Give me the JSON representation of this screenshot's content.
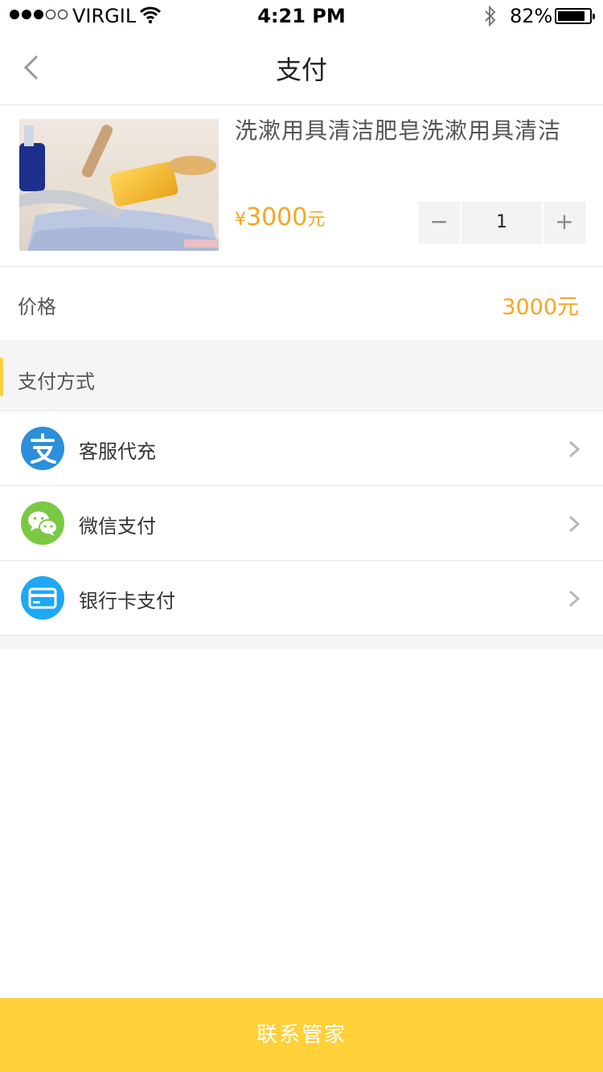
{
  "status_bar": {
    "carrier": "VIRGIL",
    "time": "4:21 PM",
    "battery_percent": "82%",
    "signal_bars_filled": 3,
    "signal_bars_total": 5,
    "battery_level": 0.82
  },
  "nav": {
    "title": "支付",
    "back_icon": "chevron-left-icon"
  },
  "product": {
    "title": "洗漱用具清洁肥皂洗漱用具清洁",
    "price_symbol": "¥",
    "price": "3000",
    "price_unit": "元",
    "quantity": "1",
    "minus_label": "−",
    "plus_label": "+"
  },
  "price_row": {
    "label": "价格",
    "value": "3000元"
  },
  "payment": {
    "section_title": "支付方式",
    "methods": [
      {
        "label": "客服代充",
        "icon": "alipay-icon",
        "color": "#2b8fdb"
      },
      {
        "label": "微信支付",
        "icon": "wechat-icon",
        "color": "#7ac943"
      },
      {
        "label": "银行卡支付",
        "icon": "bank-card-icon",
        "color": "#1ea7f5"
      }
    ]
  },
  "bottom_button": {
    "label": "联系管家"
  },
  "colors": {
    "accent": "#ffd038",
    "price": "#f5a623"
  }
}
